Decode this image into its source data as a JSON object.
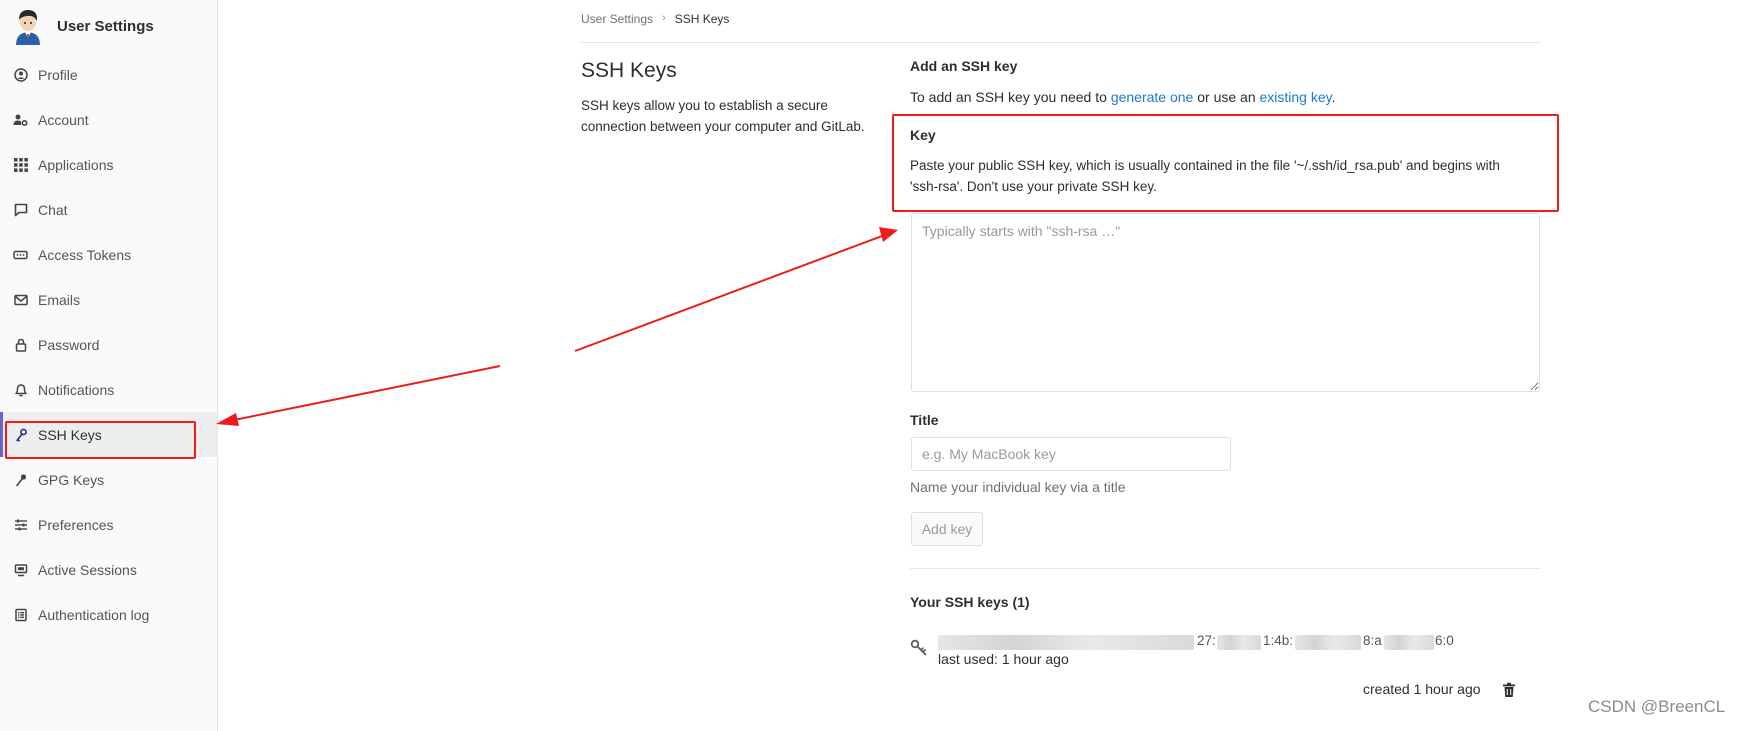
{
  "sidebar": {
    "title": "User Settings",
    "items": [
      {
        "label": "Profile",
        "icon": "profile-icon"
      },
      {
        "label": "Account",
        "icon": "account-gear-icon"
      },
      {
        "label": "Applications",
        "icon": "applications-grid-icon"
      },
      {
        "label": "Chat",
        "icon": "chat-icon"
      },
      {
        "label": "Access Tokens",
        "icon": "token-icon"
      },
      {
        "label": "Emails",
        "icon": "envelope-icon"
      },
      {
        "label": "Password",
        "icon": "lock-icon"
      },
      {
        "label": "Notifications",
        "icon": "bell-icon"
      },
      {
        "label": "SSH Keys",
        "icon": "key-icon",
        "active": true
      },
      {
        "label": "GPG Keys",
        "icon": "key-icon"
      },
      {
        "label": "Preferences",
        "icon": "sliders-icon"
      },
      {
        "label": "Active Sessions",
        "icon": "monitor-icon"
      },
      {
        "label": "Authentication log",
        "icon": "log-icon"
      }
    ]
  },
  "breadcrumb": {
    "parent": "User Settings",
    "separator": "›",
    "current": "SSH Keys"
  },
  "intro": {
    "title": "SSH Keys",
    "description": "SSH keys allow you to establish a secure connection between your computer and GitLab."
  },
  "form": {
    "heading": "Add an SSH key",
    "intro_prefix": "To add an SSH key you need to ",
    "link_generate": "generate one",
    "intro_middle": " or use an ",
    "link_existing": "existing key",
    "intro_suffix": ".",
    "key_label": "Key",
    "key_help": "Paste your public SSH key, which is usually contained in the file '~/.ssh/id_rsa.pub' and begins with 'ssh-rsa'. Don't use your private SSH key.",
    "key_placeholder": "Typically starts with \"ssh-rsa …\"",
    "title_label": "Title",
    "title_placeholder": "e.g. My MacBook key",
    "title_help": "Name your individual key via a title",
    "add_button": "Add key"
  },
  "keys": {
    "heading": "Your SSH keys (1)",
    "items": [
      {
        "fingerprint_fragments": [
          "27:",
          "1:4b:",
          "8:a",
          "6:0"
        ],
        "last_used": "last used: 1 hour ago",
        "created": "created 1 hour ago"
      }
    ]
  },
  "annotation": {
    "highlight_color": "#ee1c1c"
  },
  "watermark": "CSDN @BreenCL",
  "colors": {
    "link": "#1f78d1",
    "active_bar": "#6666c4",
    "sidebar_bg": "#fafafa"
  }
}
